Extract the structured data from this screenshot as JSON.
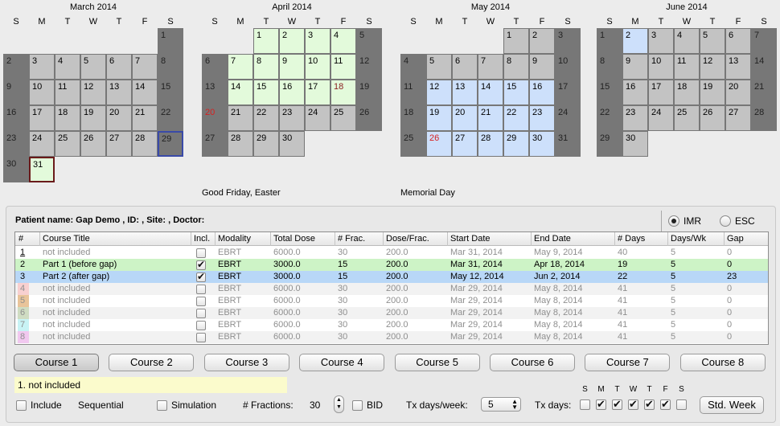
{
  "calendars": [
    {
      "title": "March 2014",
      "dow": [
        "S",
        "M",
        "T",
        "W",
        "T",
        "F",
        "S"
      ]
    },
    {
      "title": "April 2014",
      "dow": [
        "S",
        "M",
        "T",
        "W",
        "T",
        "F",
        "S"
      ]
    },
    {
      "title": "May 2014",
      "dow": [
        "S",
        "M",
        "T",
        "W",
        "T",
        "F",
        "S"
      ]
    },
    {
      "title": "June 2014",
      "dow": [
        "S",
        "M",
        "T",
        "W",
        "T",
        "F",
        "S"
      ]
    }
  ],
  "holiday_notes": {
    "april": "Good Friday, Easter",
    "may": "Memorial Day"
  },
  "patient": "Patient name: Gap Demo , ID:  , Site: , Doctor:",
  "radio": {
    "imr": "IMR",
    "esc": "ESC"
  },
  "table": {
    "headers": [
      "#",
      "Course Title",
      "Incl.",
      "Modality",
      "Total Dose",
      "# Frac.",
      "Dose/Frac.",
      "Start Date",
      "End Date",
      "# Days",
      "Days/Wk",
      "Gap"
    ],
    "rows": [
      {
        "num": "1",
        "title": "not included",
        "incl": false,
        "modality": "EBRT",
        "dose": "6000.0",
        "frac": "30",
        "dpf": "200.0",
        "start": "Mar 31, 2014",
        "end": "May 9, 2014",
        "days": "40",
        "dpw": "5",
        "gap": "0"
      },
      {
        "num": "2",
        "title": "Part 1 (before gap)",
        "incl": true,
        "modality": "EBRT",
        "dose": "3000.0",
        "frac": "15",
        "dpf": "200.0",
        "start": "Mar 31, 2014",
        "end": "Apr 18, 2014",
        "days": "19",
        "dpw": "5",
        "gap": "0"
      },
      {
        "num": "3",
        "title": "Part 2 (after gap)",
        "incl": true,
        "modality": "EBRT",
        "dose": "3000.0",
        "frac": "15",
        "dpf": "200.0",
        "start": "May 12, 2014",
        "end": "Jun 2, 2014",
        "days": "22",
        "dpw": "5",
        "gap": "23"
      },
      {
        "num": "4",
        "title": "not included",
        "incl": false,
        "modality": "EBRT",
        "dose": "6000.0",
        "frac": "30",
        "dpf": "200.0",
        "start": "Mar 29, 2014",
        "end": "May 8, 2014",
        "days": "41",
        "dpw": "5",
        "gap": "0"
      },
      {
        "num": "5",
        "title": "not included",
        "incl": false,
        "modality": "EBRT",
        "dose": "6000.0",
        "frac": "30",
        "dpf": "200.0",
        "start": "Mar 29, 2014",
        "end": "May 8, 2014",
        "days": "41",
        "dpw": "5",
        "gap": "0"
      },
      {
        "num": "6",
        "title": "not included",
        "incl": false,
        "modality": "EBRT",
        "dose": "6000.0",
        "frac": "30",
        "dpf": "200.0",
        "start": "Mar 29, 2014",
        "end": "May 8, 2014",
        "days": "41",
        "dpw": "5",
        "gap": "0"
      },
      {
        "num": "7",
        "title": "not included",
        "incl": false,
        "modality": "EBRT",
        "dose": "6000.0",
        "frac": "30",
        "dpf": "200.0",
        "start": "Mar 29, 2014",
        "end": "May 8, 2014",
        "days": "41",
        "dpw": "5",
        "gap": "0"
      },
      {
        "num": "8",
        "title": "not included",
        "incl": false,
        "modality": "EBRT",
        "dose": "6000.0",
        "frac": "30",
        "dpf": "200.0",
        "start": "Mar 29, 2014",
        "end": "May 8, 2014",
        "days": "41",
        "dpw": "5",
        "gap": "0"
      }
    ],
    "num_colors": [
      "#ffffff",
      "#cdf3c6",
      "#b8d7f7",
      "#f8d0d0",
      "#e9c49a",
      "#cfdcc2",
      "#c8f3f5",
      "#f1c8ef"
    ]
  },
  "course_buttons": [
    "Course 1",
    "Course 2",
    "Course 3",
    "Course 4",
    "Course 5",
    "Course 6",
    "Course 7",
    "Course 8"
  ],
  "note": "1. not included",
  "controls": {
    "include": "Include",
    "sequential": "Sequential",
    "simulation": "Simulation",
    "fractions_label": "# Fractions:",
    "fractions_value": "30",
    "bid": "BID",
    "tx_days_week_label": "Tx days/week:",
    "tx_days_week_value": "5",
    "tx_days_label": "Tx days:",
    "tx_days_letters": [
      "S",
      "M",
      "T",
      "W",
      "T",
      "F",
      "S"
    ],
    "std_week": "Std. Week"
  }
}
